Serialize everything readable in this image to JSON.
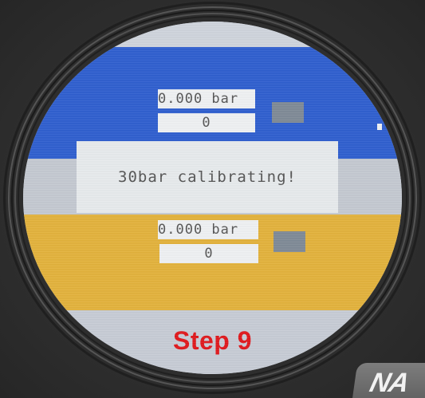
{
  "channel_1": {
    "value_label": "0.000 bar",
    "count_label": "0"
  },
  "status": {
    "message": "30bar calibrating!"
  },
  "channel_2": {
    "value_label": "0.000 bar",
    "count_label": "0"
  },
  "step": {
    "label": "Step 9"
  },
  "logo": {
    "text": "NA"
  },
  "colors": {
    "blue_band": "#2f5fcf",
    "yellow_band": "#e3b23c",
    "step_text": "#e0181c",
    "indicator": "#7f8a96"
  }
}
